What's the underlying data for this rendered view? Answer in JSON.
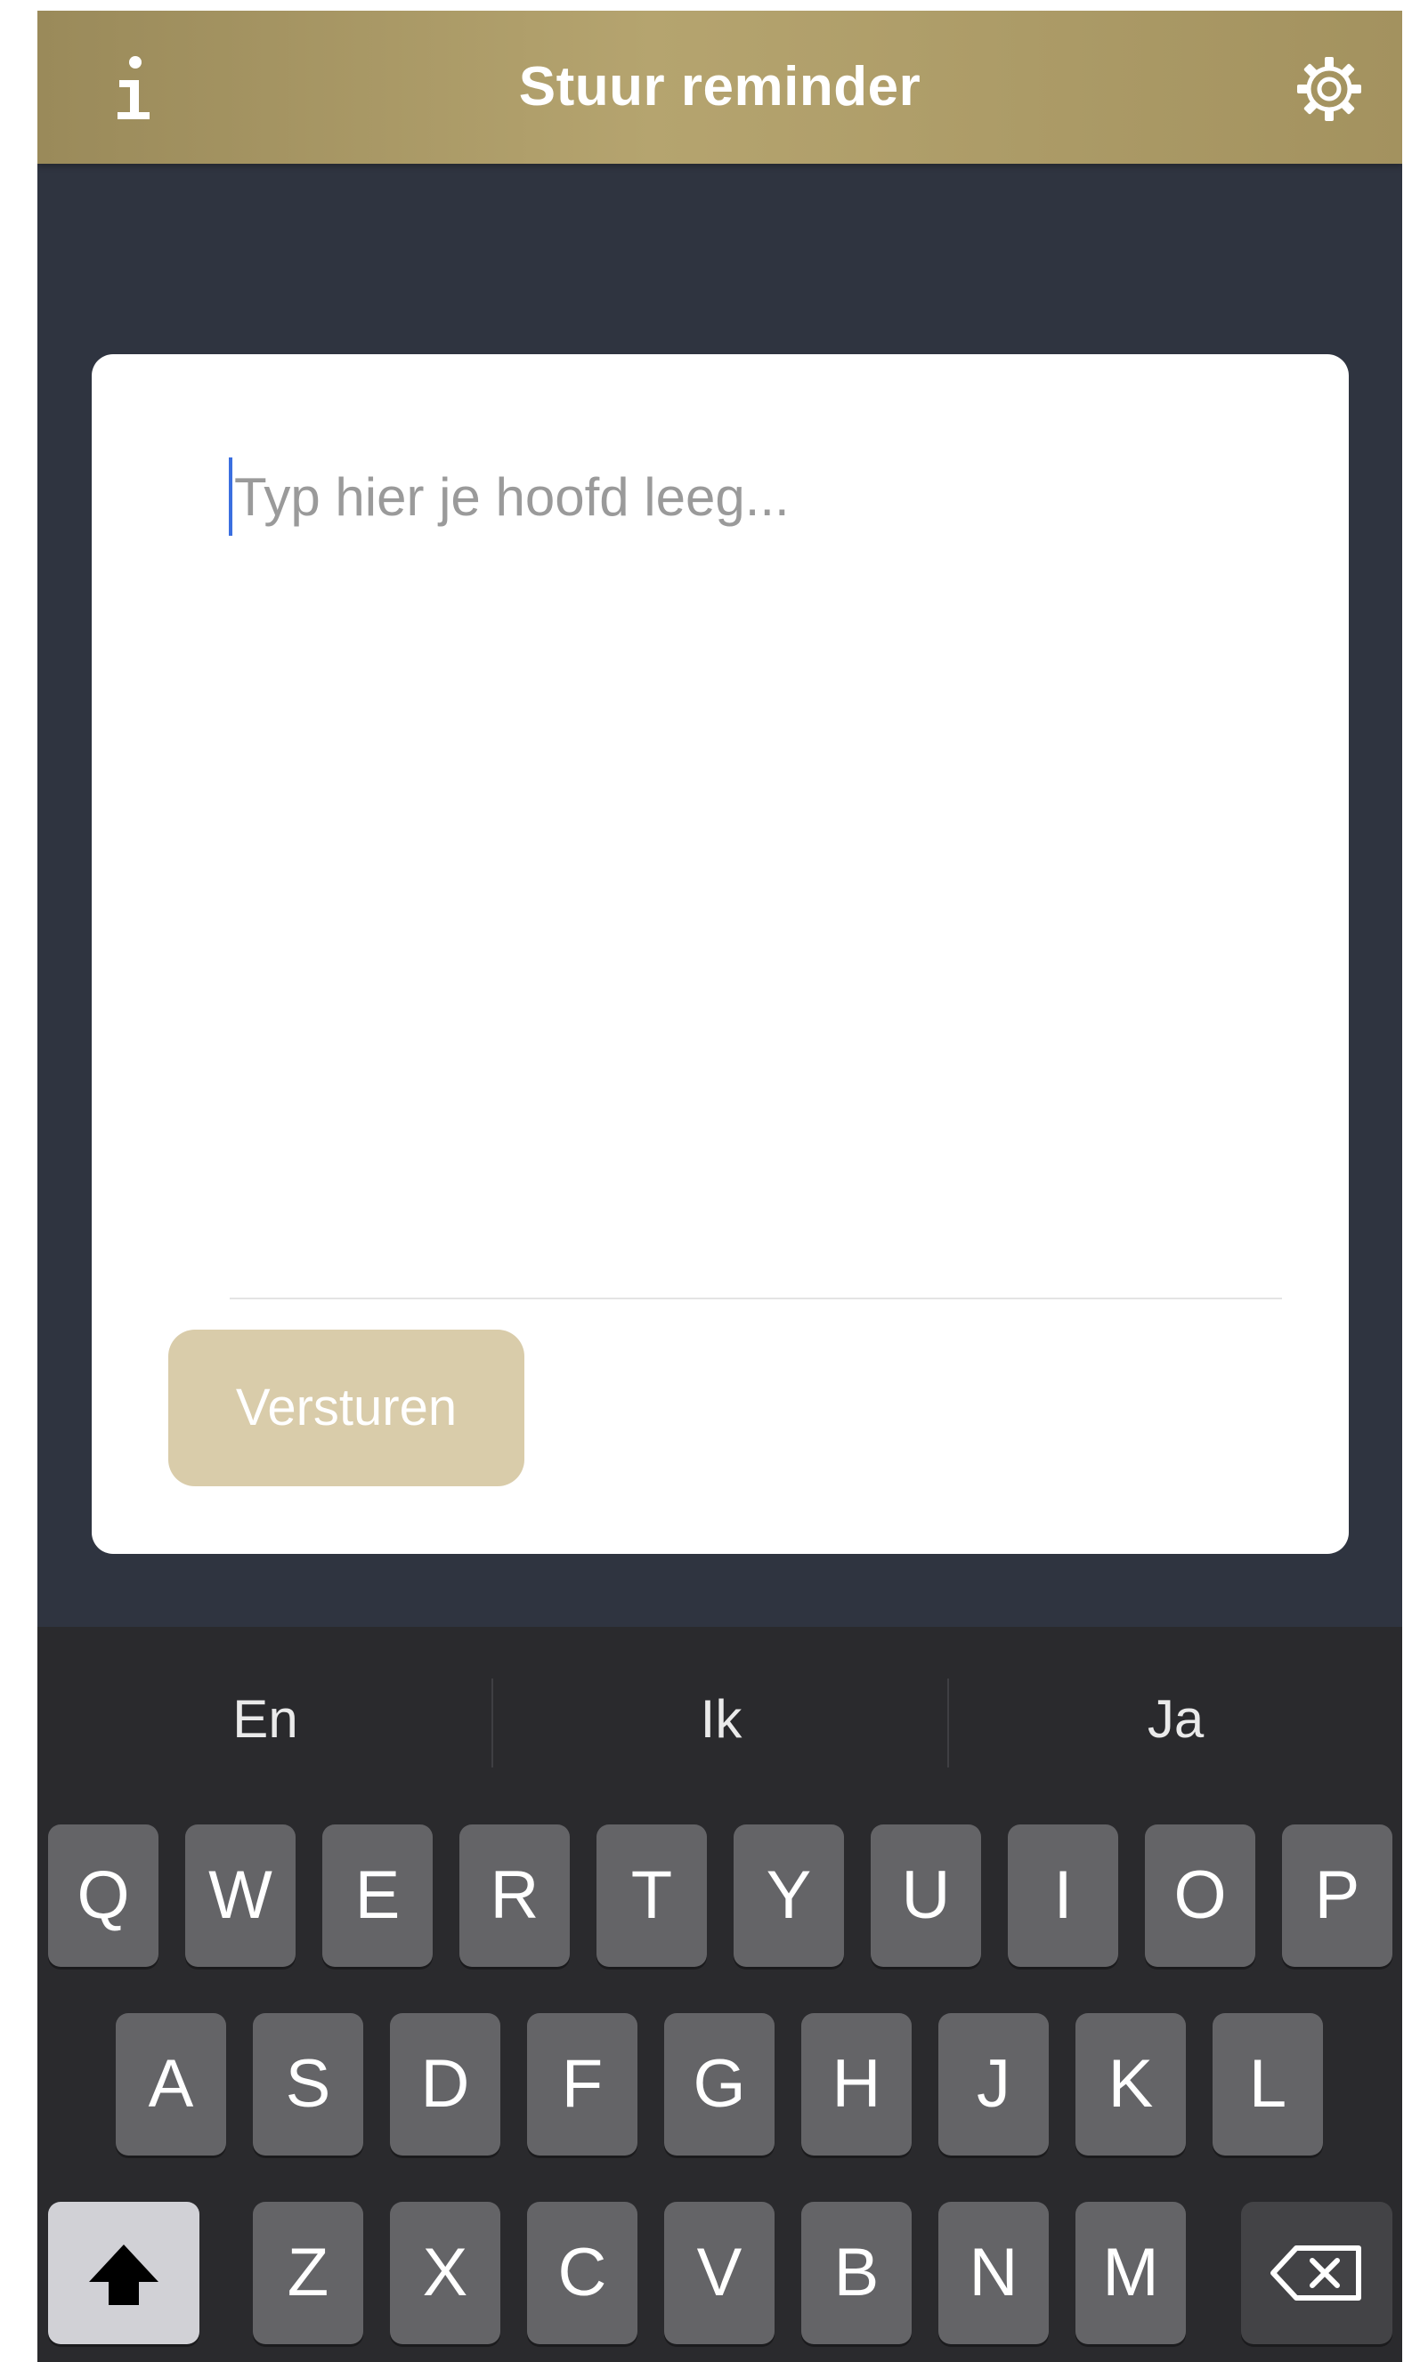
{
  "header": {
    "title": "Stuur reminder",
    "info_icon": "info-icon",
    "settings_icon": "gear-icon"
  },
  "card": {
    "input_placeholder": "Typ hier je hoofd leeg...",
    "input_value": "",
    "send_label": "Versturen"
  },
  "keyboard": {
    "suggestions": [
      "En",
      "Ik",
      "Ja"
    ],
    "row1": [
      "Q",
      "W",
      "E",
      "R",
      "T",
      "Y",
      "U",
      "I",
      "O",
      "P"
    ],
    "row2": [
      "A",
      "S",
      "D",
      "F",
      "G",
      "H",
      "J",
      "K",
      "L"
    ],
    "row3": [
      "Z",
      "X",
      "C",
      "V",
      "B",
      "N",
      "M"
    ],
    "shift_icon": "shift-icon",
    "backspace_icon": "backspace-icon"
  },
  "colors": {
    "header_gold": "#a8975f",
    "background": "#2f3440",
    "button_disabled": "#d9ccaa",
    "caret": "#3b6fe0",
    "keyboard_bg": "#2a2a2d",
    "key_bg": "#646467"
  }
}
